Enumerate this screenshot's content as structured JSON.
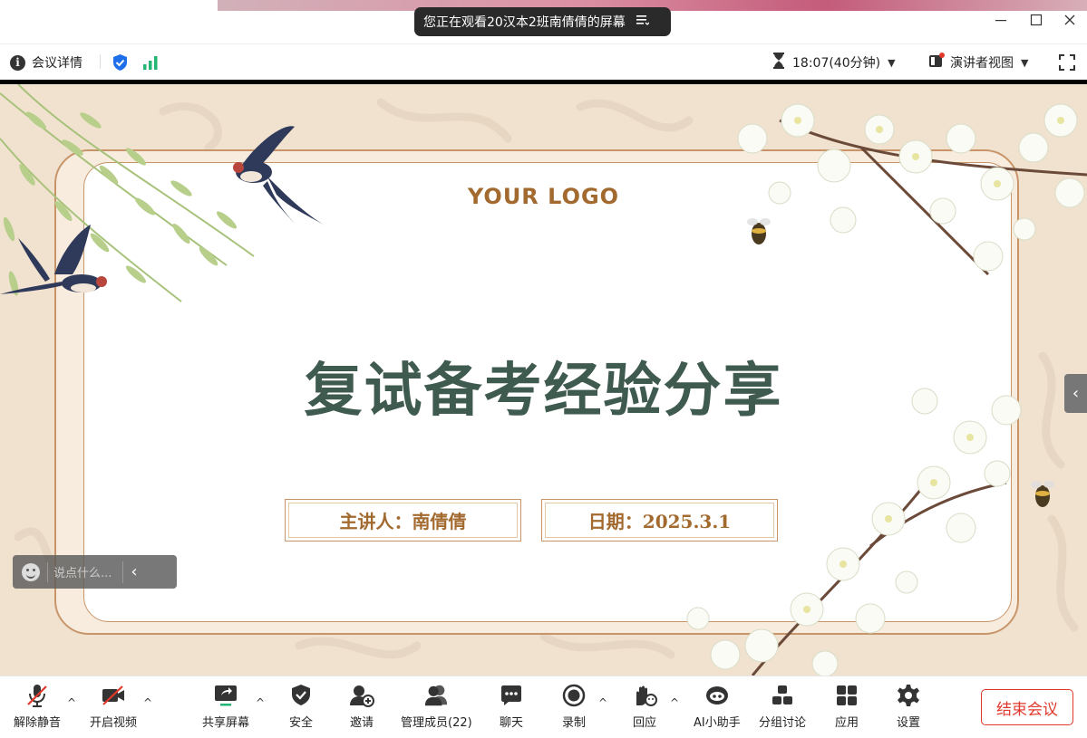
{
  "titlebar": {
    "share_notice": "您正在观看20汉本2班南倩倩的屏幕",
    "share_icon": "list-icon",
    "controls": [
      "minimize",
      "maximize",
      "close"
    ]
  },
  "infobar": {
    "meeting_details": "会议详情",
    "timer": "18:07(40分钟)",
    "view_mode": "演讲者视图",
    "icons": [
      "info-icon",
      "shield-icon",
      "signal-icon",
      "hourglass-icon",
      "speaker-view-icon",
      "fullscreen-icon"
    ]
  },
  "slide": {
    "logo": "YOUR LOGO",
    "title": "复试备考经验分享",
    "speaker": "主讲人：南倩倩",
    "date": "日期：2025.3.1"
  },
  "comment": {
    "placeholder": "说点什么..."
  },
  "toolbar": {
    "unmute": "解除静音",
    "start_video": "开启视频",
    "share_screen": "共享屏幕",
    "security": "安全",
    "invite": "邀请",
    "participants": "管理成员(22)",
    "chat": "聊天",
    "record": "录制",
    "reactions": "回应",
    "ai_assistant": "AI小助手",
    "breakout": "分组讨论",
    "apps": "应用",
    "settings": "设置",
    "end_meeting": "结束会议"
  },
  "colors": {
    "accent_green": "#22b573",
    "shield_blue": "#1f6feb",
    "end_red": "#e0392b",
    "title_green": "#3f5a4f",
    "gold": "#a36a30"
  }
}
